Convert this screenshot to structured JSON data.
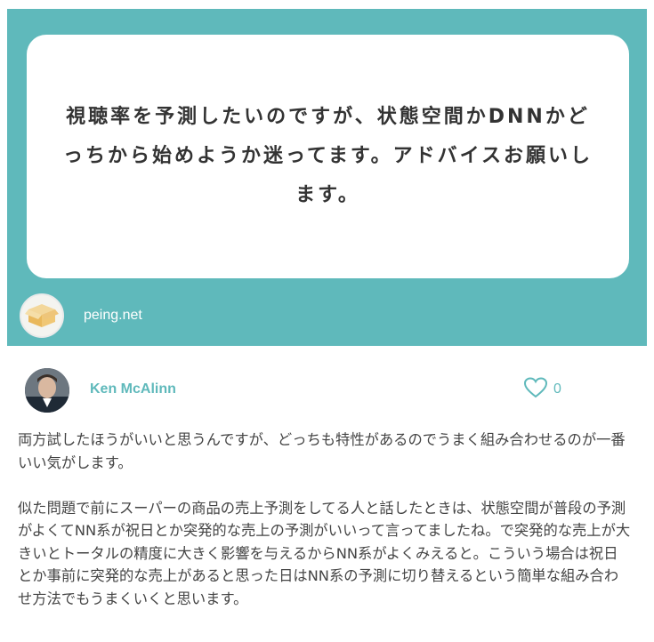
{
  "question": {
    "text": "視聴率を予測したいのですが、状態空間かDNNかどっちから始めようか迷ってます。アドバイスお願いします。"
  },
  "brand": {
    "site": "peing.net",
    "logo_icon": "box-icon"
  },
  "answer": {
    "author": "Ken McAlinn",
    "like_icon": "heart-outline-icon",
    "like_count": "0",
    "paragraphs": [
      "両方試したほうがいいと思うんですが、どっちも特性があるのでうまく組み合わせるのが一番いい気がします。",
      "似た問題で前にスーパーの商品の売上予測をしてる人と話したときは、状態空間が普段の予測がよくてNN系が祝日とか突発的な売上の予測がいいって言ってましたね。で突発的な売上が大きいとトータルの精度に大きく影響を与えるからNN系がよくみえると。こういう場合は祝日とか事前に突発的な売上があると思った日はNN系の予測に切り替えるという簡単な組み合わせ方法でもうまくいくと思います。"
    ]
  },
  "colors": {
    "accent": "#5fb9bb",
    "text": "#444444"
  }
}
